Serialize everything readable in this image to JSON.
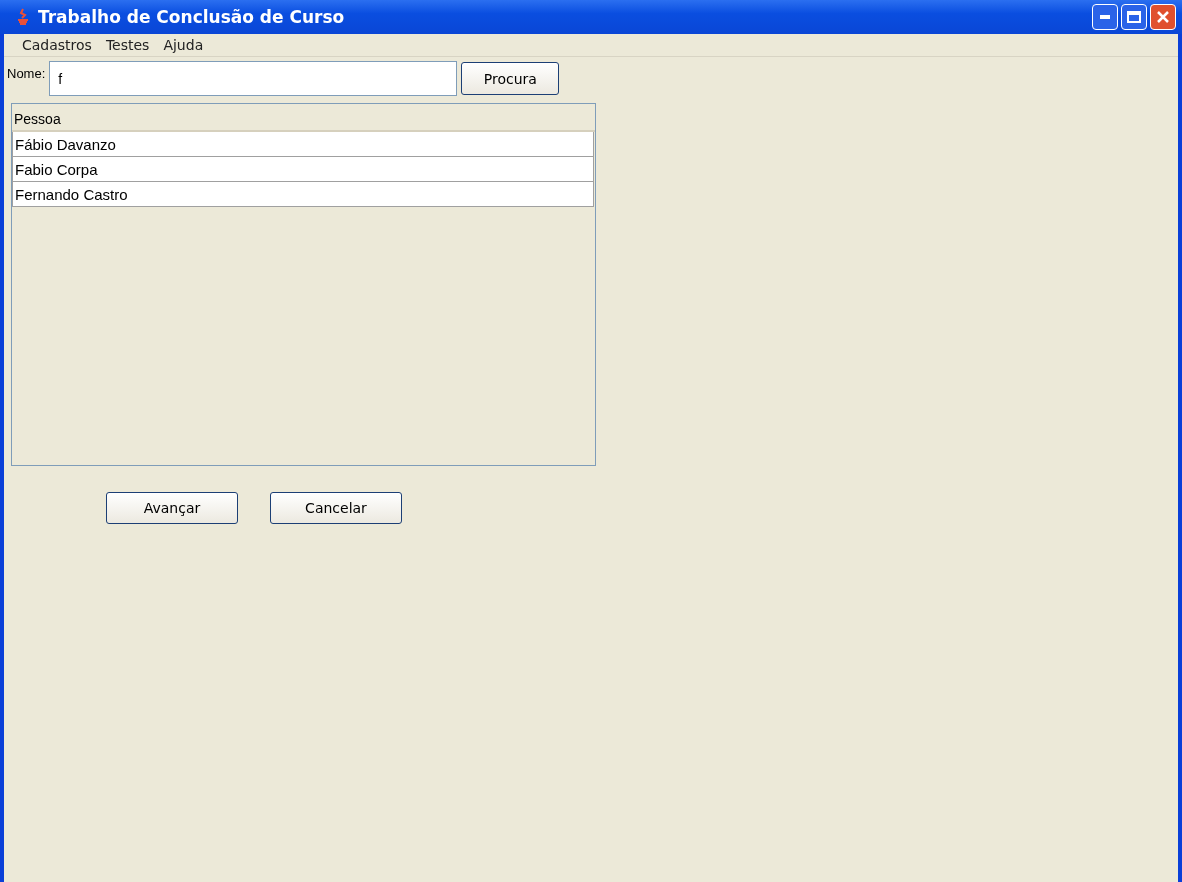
{
  "window": {
    "title": "Trabalho de Conclusão de Curso"
  },
  "menu": [
    "Cadastros",
    "Testes",
    "Ajuda"
  ],
  "search": {
    "label": "Nome:",
    "value": "f",
    "button": "Procura"
  },
  "table": {
    "columns": [
      "Pessoa"
    ],
    "rows": [
      {
        "cells": [
          "Fábio Davanzo"
        ],
        "selected": false
      },
      {
        "cells": [
          "Fabio Corpa"
        ],
        "selected": false
      },
      {
        "cells": [
          "Fernando Castro"
        ],
        "selected": false
      }
    ]
  },
  "buttons": [
    "Avançar",
    "Cancelar"
  ]
}
